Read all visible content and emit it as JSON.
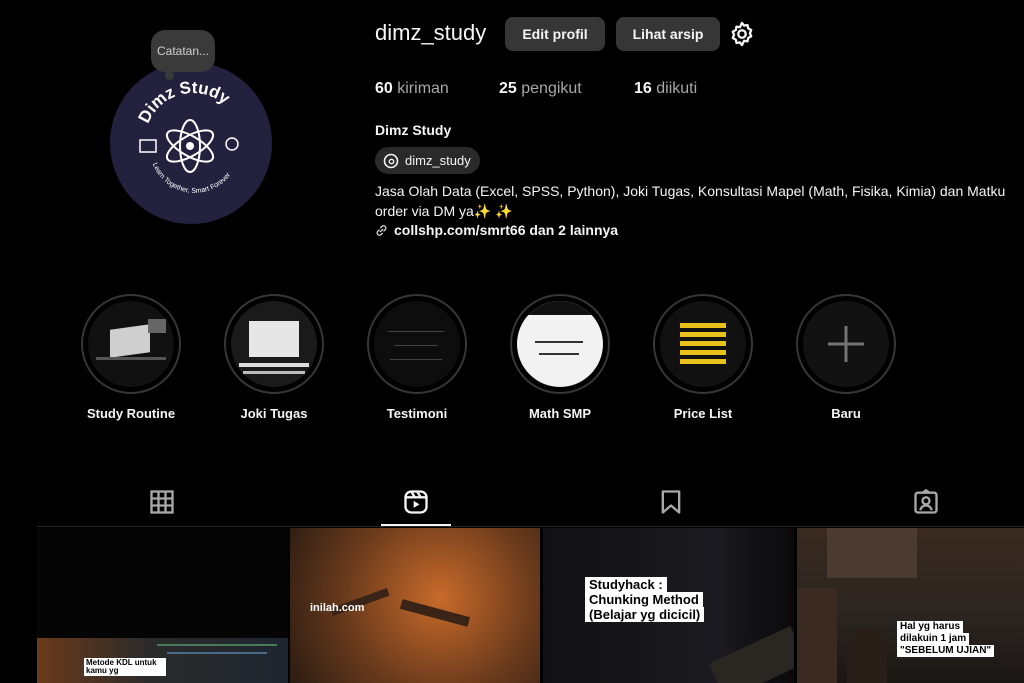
{
  "profile": {
    "username": "dimz_study",
    "note": "Catatan...",
    "avatar_text_top": "Dimz Study",
    "avatar_text_bottom": "Learn Together, Smart Forever",
    "edit_button": "Edit profil",
    "archive_button": "Lihat arsip",
    "stats": [
      {
        "count": "60",
        "label": "kiriman"
      },
      {
        "count": "25",
        "label": "pengikut"
      },
      {
        "count": "16",
        "label": "diikuti"
      }
    ],
    "full_name": "Dimz Study",
    "threads_handle": "dimz_study",
    "bio_line1": "Jasa Olah Data (Excel, SPSS, Python), Joki Tugas, Konsultasi Mapel (Math, Fisika, Kimia) dan Matku",
    "bio_line2": "order via DM ya✨ ✨",
    "link_text": "collshp.com/smrt66 dan 2 lainnya"
  },
  "highlights": [
    {
      "label": "Study Routine"
    },
    {
      "label": "Joki Tugas"
    },
    {
      "label": "Testimoni"
    },
    {
      "label": "Math SMP"
    },
    {
      "label": "Price List"
    },
    {
      "label": "Baru"
    }
  ],
  "tabs": [
    "grid-icon",
    "reels-icon",
    "saved-icon",
    "tagged-icon"
  ],
  "posts": [
    {
      "caption": "Metode KDL untuk kamu yg"
    },
    {
      "caption": "inilah.com"
    },
    {
      "caption_lines": [
        "Studyhack :",
        "Chunking Method",
        "(Belajar yg dicicil)"
      ]
    },
    {
      "caption_lines": [
        "Hal yg harus",
        "dilakuin 1 jam",
        "\"SEBELUM UJIAN\""
      ]
    }
  ],
  "colors": {
    "background": "#000000",
    "button": "#363636",
    "avatar_bg": "#24213f",
    "muted": "#a8a8a8"
  }
}
